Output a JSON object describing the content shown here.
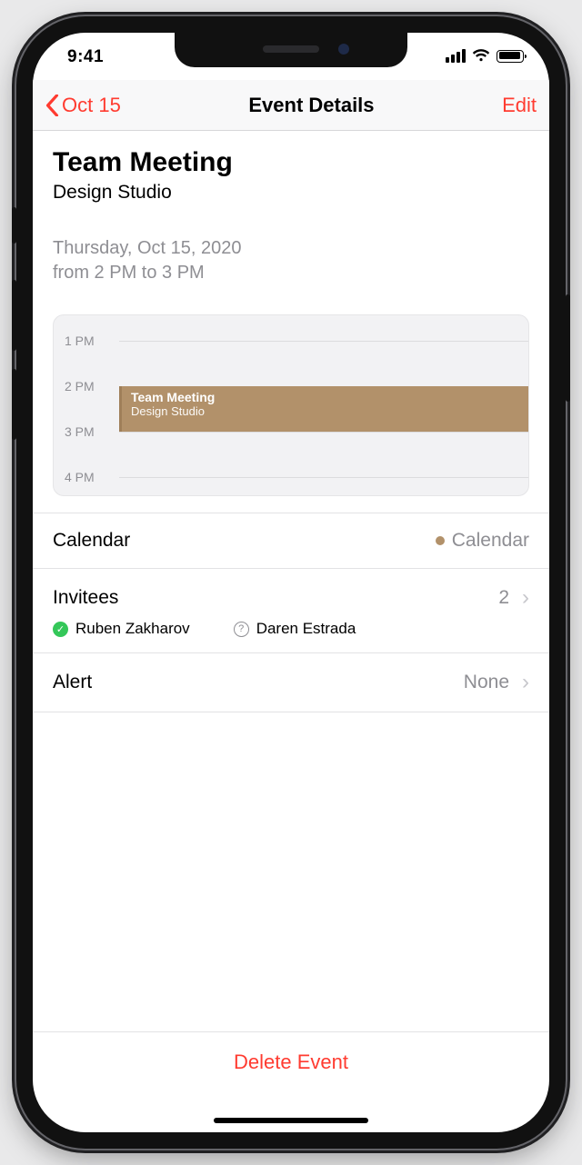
{
  "status": {
    "time": "9:41"
  },
  "nav": {
    "back_label": "Oct 15",
    "title": "Event Details",
    "edit_label": "Edit"
  },
  "event": {
    "title": "Team Meeting",
    "location": "Design Studio",
    "date_line": "Thursday, Oct 15, 2020",
    "time_line": "from 2 PM to 3 PM"
  },
  "timeline": {
    "hours": [
      "1 PM",
      "2 PM",
      "3 PM",
      "4 PM"
    ],
    "block_title": "Team Meeting",
    "block_sub": "Design Studio"
  },
  "rows": {
    "calendar_label": "Calendar",
    "calendar_value": "Calendar",
    "invitees_label": "Invitees",
    "invitees_count": "2",
    "alert_label": "Alert",
    "alert_value": "None"
  },
  "invitees": [
    {
      "name": "Ruben Zakharov",
      "status": "accepted"
    },
    {
      "name": "Daren Estrada",
      "status": "pending"
    }
  ],
  "delete_label": "Delete Event"
}
